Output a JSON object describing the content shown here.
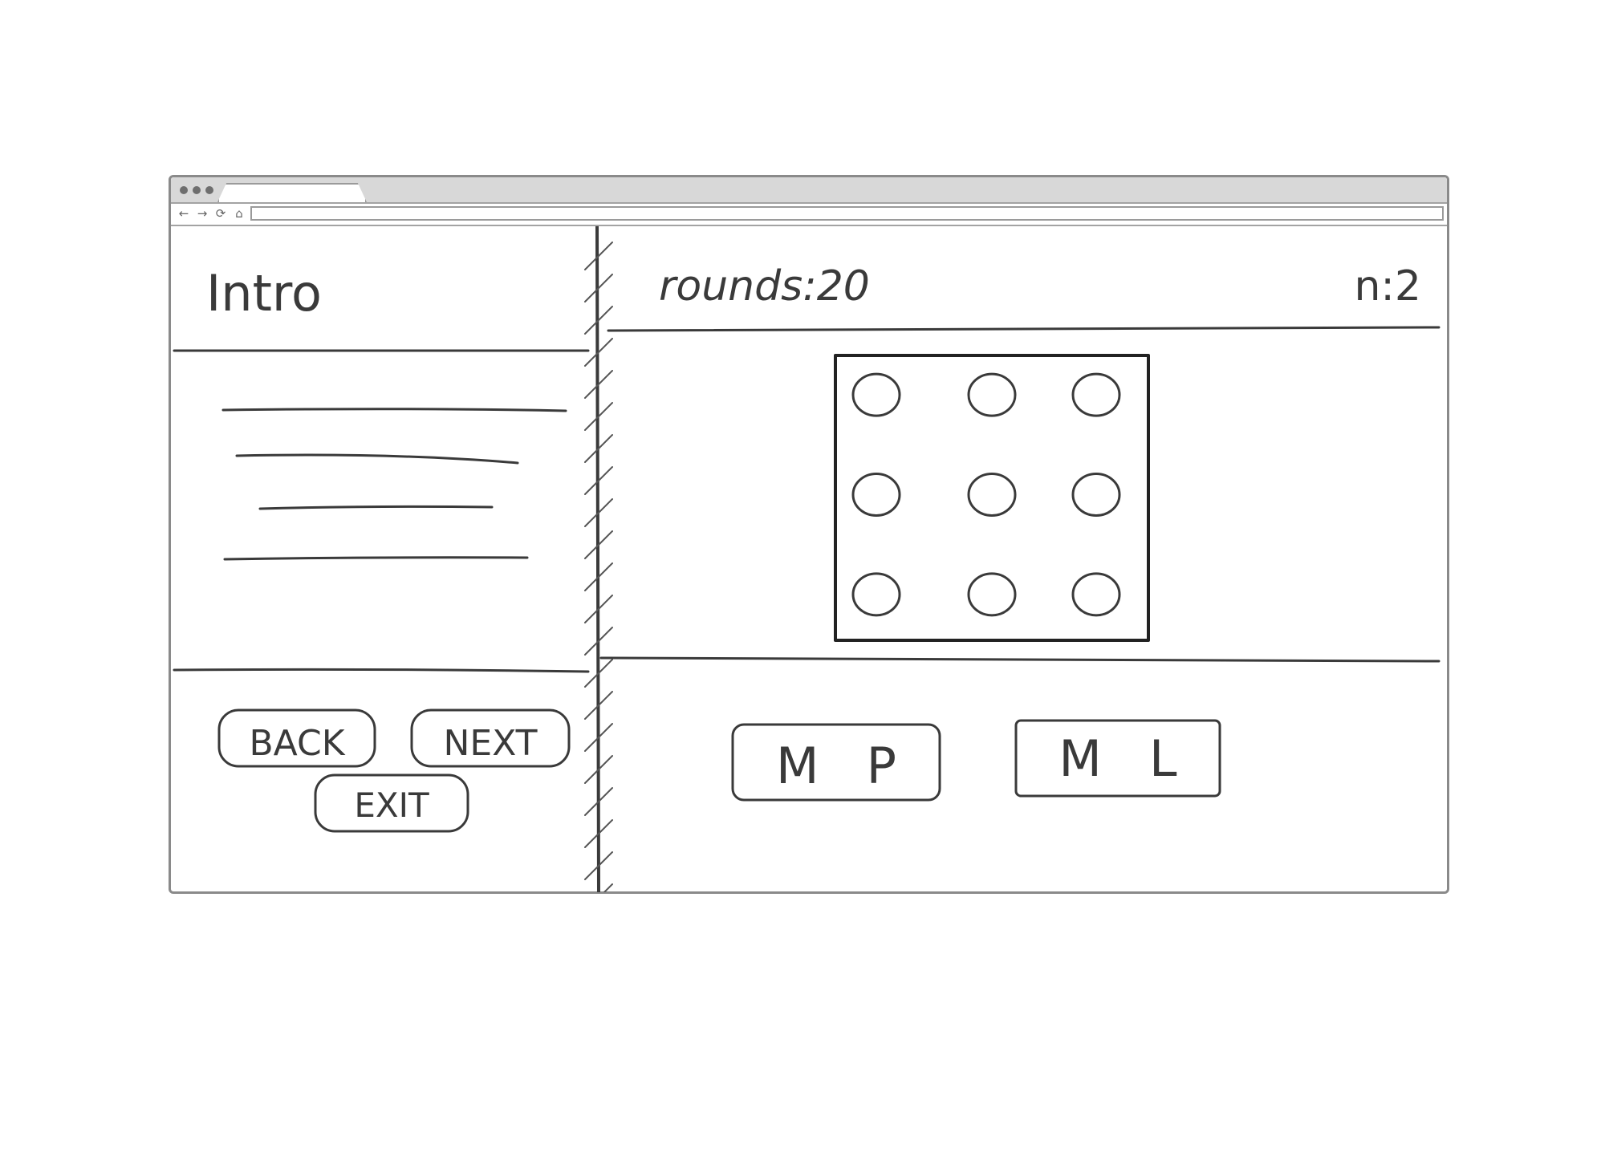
{
  "browser": {
    "nav": [
      {
        "name": "back-arrow-icon",
        "glyph": "←"
      },
      {
        "name": "forward-arrow-icon",
        "glyph": "→"
      },
      {
        "name": "reload-icon",
        "glyph": "⟳"
      },
      {
        "name": "home-icon",
        "glyph": "⌂"
      }
    ]
  },
  "left_panel": {
    "title": "Intro",
    "buttons": {
      "back": "BACK",
      "next": "NEXT",
      "exit": "EXIT"
    }
  },
  "right_panel": {
    "rounds_label": "rounds:20",
    "n_label": "n:2",
    "grid": {
      "rows": 3,
      "cols": 3
    },
    "buttons": {
      "mp": "M   P",
      "ml": "M   L"
    }
  }
}
